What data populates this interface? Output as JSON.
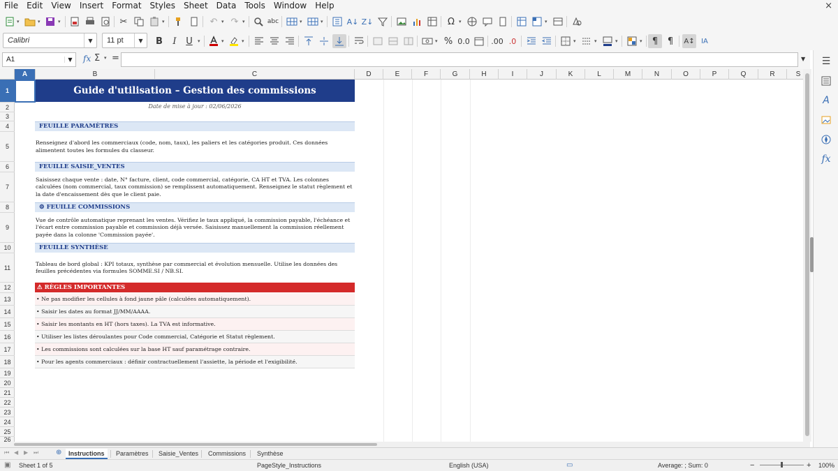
{
  "menu": [
    "File",
    "Edit",
    "View",
    "Insert",
    "Format",
    "Styles",
    "Sheet",
    "Data",
    "Tools",
    "Window",
    "Help"
  ],
  "window_close": "×",
  "toolbar": {
    "font_name": "Calibri",
    "font_size": "11 pt",
    "bold": "B",
    "italic": "I",
    "underline": "U",
    "percent": "%",
    "decimal_zero": "0.0",
    "add_decimal": ".00",
    "remove_decimal": ".0"
  },
  "formula_bar": {
    "cell_ref": "A1",
    "fx": "fx",
    "sum": "Σ",
    "equals": "=",
    "value": ""
  },
  "columns": [
    "A",
    "B",
    "C",
    "D",
    "E",
    "F",
    "G",
    "H",
    "I",
    "J",
    "K",
    "L",
    "M",
    "N",
    "O",
    "P",
    "Q",
    "R",
    "S"
  ],
  "rows": [
    "1",
    "2",
    "3",
    "4",
    "5",
    "6",
    "7",
    "8",
    "9",
    "10",
    "11",
    "12",
    "13",
    "14",
    "15",
    "16",
    "17",
    "18",
    "19",
    "20",
    "21",
    "22",
    "23",
    "24",
    "25",
    "26"
  ],
  "sheet": {
    "title": "Guide d'utilisation – Gestion des commissions",
    "date": "Date de mise à jour : 02/06/2026",
    "sections": [
      {
        "header": "FEUILLE PARAMÈTRES",
        "body": "Renseignez d'abord les commerciaux (code, nom, taux), les paliers et les catégories produit. Ces données alimentent toutes les formules du classeur."
      },
      {
        "header": "FEUILLE SAISIE_VENTES",
        "body": "Saisissez chaque vente : date, N° facture, client, code commercial, catégorie, CA HT et TVA. Les colonnes calculées (nom commercial, taux commission) se remplissent automatiquement. Renseignez le statut règlement et la date d'encaissement dès que le client paie."
      },
      {
        "header": "⚙  FEUILLE COMMISSIONS",
        "body": "Vue de contrôle automatique reprenant les ventes. Vérifiez le taux appliqué, la commission payable, l'échéance et l'écart entre commission payable et commission déjà versée. Saisissez manuellement la commission réellement payée dans la colonne 'Commission payée'."
      },
      {
        "header": "FEUILLE SYNTHÈSE",
        "body": "Tableau de bord global : KPI totaux, synthèse par commercial et évolution mensuelle. Utilise les données des feuilles précédentes via formules SOMME.SI / NB.SI."
      }
    ],
    "rules_header": "⚠  RÈGLES IMPORTANTES",
    "rules": [
      "• Ne pas modifier les cellules à fond jaune pâle (calculées automatiquement).",
      "• Saisir les dates au format JJ/MM/AAAA.",
      "• Saisir les montants en HT (hors taxes). La TVA est informative.",
      "• Utiliser les listes déroulantes pour Code commercial, Catégorie et Statut règlement.",
      "• Les commissions sont calculées sur la base HT sauf paramétrage contraire.",
      "• Pour les agents commerciaux : définir contractuellement l'assiette, la période et l'exigibilité."
    ]
  },
  "tabs": [
    "Instructions",
    "Paramètres",
    "Saisie_Ventes",
    "Commissions",
    "Synthèse"
  ],
  "status": {
    "sheet": "Sheet 1 of 5",
    "page_style": "PageStyle_Instructions",
    "language": "English (USA)",
    "summary": "Average: ; Sum: 0",
    "zoom": "100%"
  },
  "colors": {
    "title_bg": "#1f3d8a",
    "section_bg": "#dce7f5",
    "rules_bg": "#d42a2a",
    "selection": "#3a6fb5"
  }
}
